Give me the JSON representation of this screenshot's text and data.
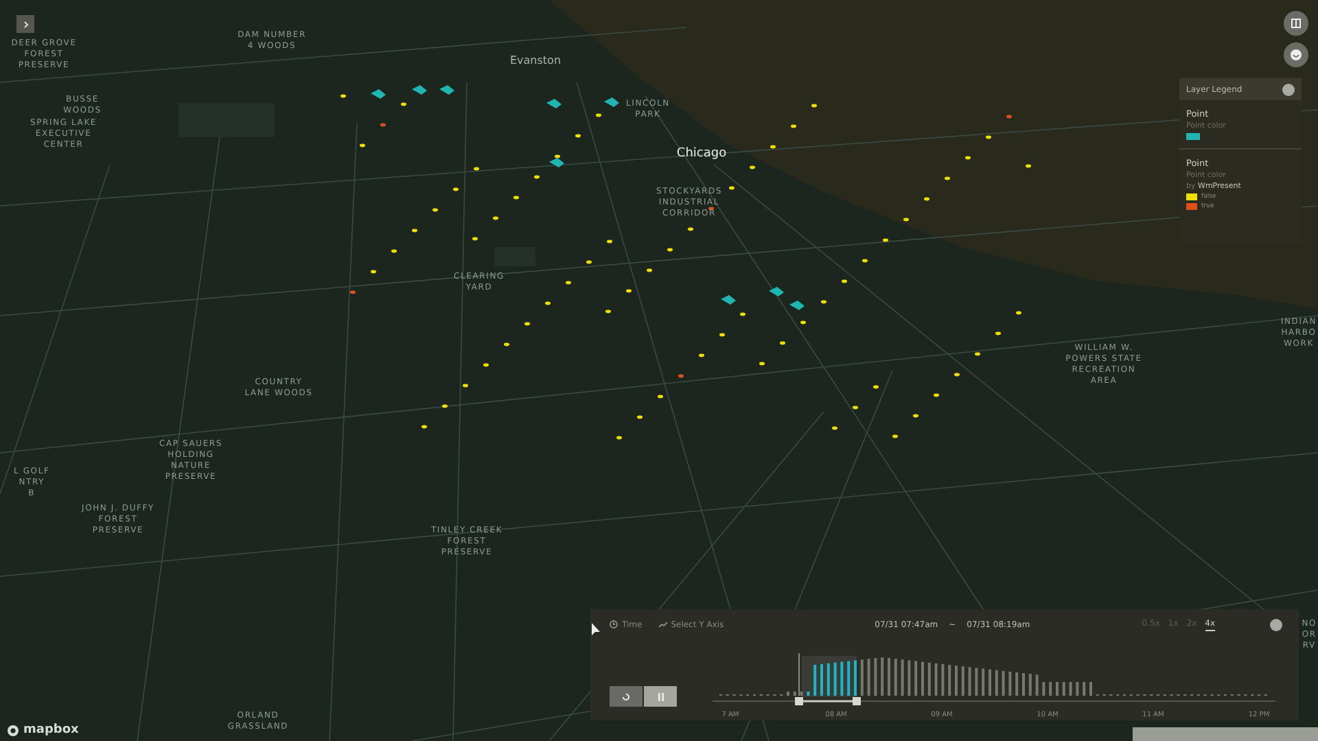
{
  "map": {
    "labels": [
      {
        "text": "DEER GROVE\nFOREST\nPRESERVE",
        "kind": "area"
      },
      {
        "text": "DAM NUMBER\n4 WOODS",
        "kind": "area"
      },
      {
        "text": "BUSSE\nWOODS",
        "kind": "area"
      },
      {
        "text": "SPRING LAKE\nEXECUTIVE\nCENTER",
        "kind": "area"
      },
      {
        "text": "Evanston",
        "kind": "city"
      },
      {
        "text": "LINCOLN\nPARK",
        "kind": "area"
      },
      {
        "text": "Chicago",
        "kind": "major"
      },
      {
        "text": "STOCKYARDS\nINDUSTRIAL\nCORRIDOR",
        "kind": "area"
      },
      {
        "text": "CLEARING\nYARD",
        "kind": "area"
      },
      {
        "text": "COUNTRY\nLANE WOODS",
        "kind": "area"
      },
      {
        "text": "CAP SAUERS\nHOLDING\nNATURE\nPRESERVE",
        "kind": "area"
      },
      {
        "text": "L GOLF\nNTRY\nB",
        "kind": "area"
      },
      {
        "text": "JOHN J. DUFFY\nFOREST\nPRESERVE",
        "kind": "area"
      },
      {
        "text": "TINLEY CREEK\nFOREST\nPRESERVE",
        "kind": "area"
      },
      {
        "text": "ORLAND\nGRASSLAND",
        "kind": "area"
      },
      {
        "text": "WILLIAM W.\nPOWERS STATE\nRECREATION\nAREA",
        "kind": "area"
      },
      {
        "text": "INDIAN\nHARBO\nWORK",
        "kind": "area"
      },
      {
        "text": "NO\nOR\nRV",
        "kind": "area"
      }
    ],
    "attribution": "mapbox"
  },
  "legend": {
    "title": "Layer Legend",
    "layers": [
      {
        "name": "Point",
        "label": "Point color",
        "kind": "single",
        "swatches": [
          {
            "color": "#1fb5b0"
          }
        ]
      },
      {
        "name": "Point",
        "label": "Point color",
        "kind": "categorical",
        "by": "by",
        "field": "WmPresent",
        "swatches": [
          {
            "color": "#f0e000",
            "label": "false"
          },
          {
            "color": "#e0501a",
            "label": "true"
          }
        ]
      }
    ]
  },
  "timeline": {
    "field": "Time",
    "y_axis": "Select Y Axis",
    "start": "07/31 07:47am",
    "separator": "~",
    "end": "07/31 08:19am",
    "speeds": [
      {
        "label": "0.5x",
        "selected": false
      },
      {
        "label": "1x",
        "selected": false
      },
      {
        "label": "2x",
        "selected": false
      },
      {
        "label": "4x",
        "selected": true
      }
    ],
    "playing": true,
    "ticks": [
      "7 AM",
      "08 AM",
      "09 AM",
      "10 AM",
      "11 AM",
      "12 PM"
    ]
  }
}
